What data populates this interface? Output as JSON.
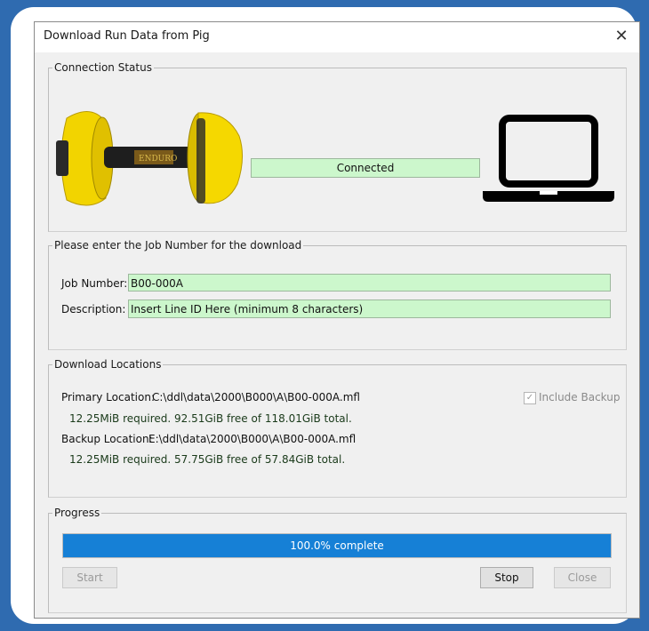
{
  "dialog": {
    "title": "Download Run Data from Pig",
    "close_glyph": "✕"
  },
  "connection": {
    "legend": "Connection Status",
    "status": "Connected",
    "pig_brand": "ENDURO",
    "status_color": "#ccf7cc"
  },
  "job": {
    "legend": "Please enter the Job Number for the download",
    "job_number_label": "Job Number:",
    "job_number_value": "B00-000A",
    "description_label": "Description:",
    "description_value": "Insert Line ID Here (minimum 8 characters)"
  },
  "locations": {
    "legend": "Download Locations",
    "primary_label": "Primary Location:",
    "primary_path": "C:\\ddl\\data\\2000\\B000\\A\\B00-000A.mfl",
    "primary_info": "12.25MiB required. 92.51GiB free of 118.01GiB total.",
    "backup_label": "Backup Location:",
    "backup_path": "E:\\ddl\\data\\2000\\B000\\A\\B00-000A.mfl",
    "backup_info": "12.25MiB required. 57.75GiB free of 57.84GiB total.",
    "include_backup_label": "Include Backup",
    "include_backup_checked": true
  },
  "progress": {
    "legend": "Progress",
    "percent": 100.0,
    "text": "100.0% complete",
    "bar_color": "#1680d6"
  },
  "buttons": {
    "start": "Start",
    "stop": "Stop",
    "close": "Close"
  },
  "icons": {
    "close": "close-icon",
    "pig": "pig-device-icon",
    "laptop": "laptop-icon",
    "checkbox": "checkmark-icon"
  }
}
